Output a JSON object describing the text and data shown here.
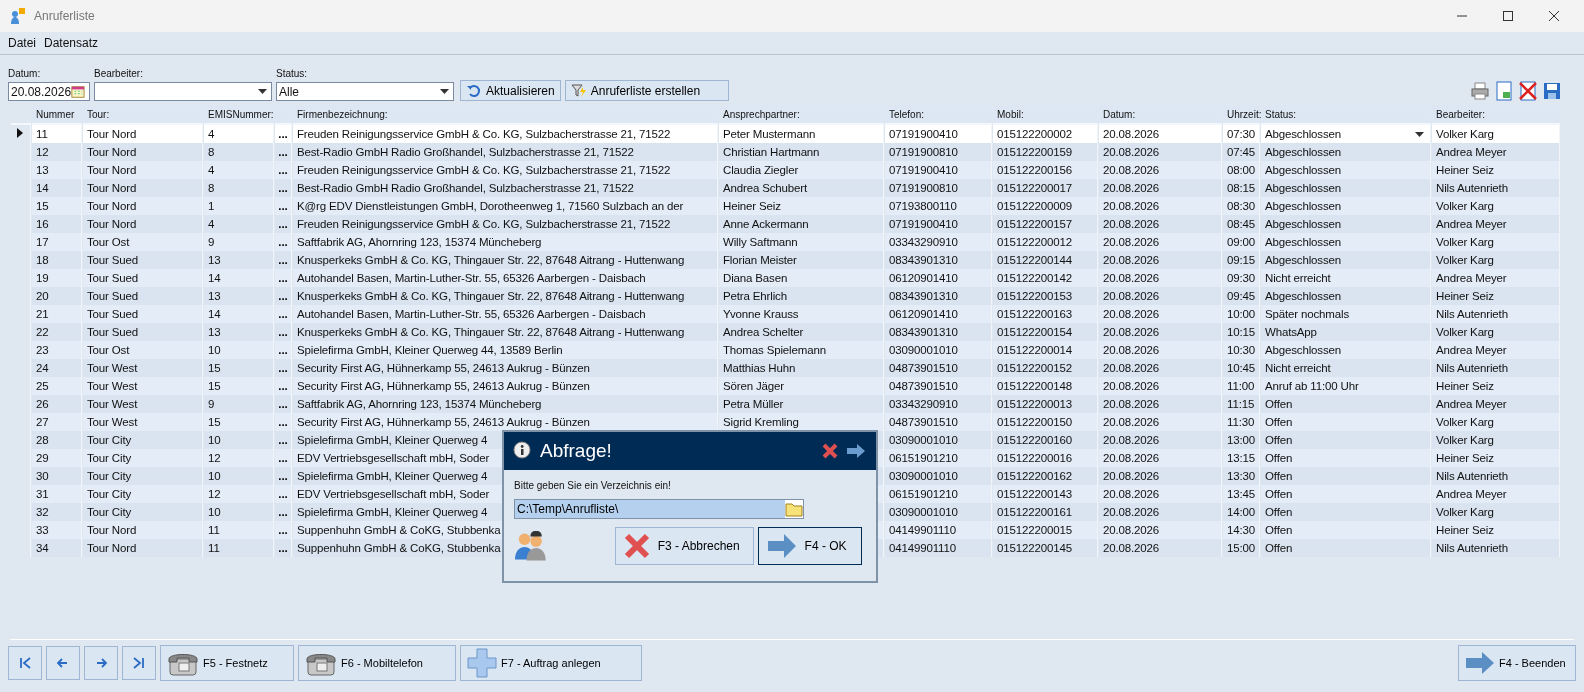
{
  "window": {
    "title": "Anruferliste"
  },
  "menu": [
    {
      "label": "Datei"
    },
    {
      "label": "Datensatz"
    }
  ],
  "filters": {
    "datum": {
      "label": "Datum:",
      "value": "20.08.2026"
    },
    "bearbeiter": {
      "label": "Bearbeiter:"
    },
    "status": {
      "label": "Status:",
      "value": "Alle"
    }
  },
  "actions": [
    {
      "kind": "refresh",
      "label": "Aktualisieren"
    },
    {
      "kind": "filter",
      "label": "Anruferliste erstellen"
    }
  ],
  "table": {
    "columns": [
      "Nummer",
      "Tour:",
      "EMISNummer:",
      "Firmenbezeichnung:",
      "Ansprechpartner:",
      "Telefon:",
      "Mobil:",
      "Datum:",
      "Uhrzeit:",
      "Status:",
      "Bearbeiter:"
    ],
    "rows": [
      {
        "selected": true,
        "more": "...",
        "cells": [
          "11",
          "Tour Nord",
          "4",
          "Freuden Reinigungsservice GmbH & Co. KG, Sulzbacherstrasse 21, 71522",
          "Peter Mustermann",
          "07191900410",
          "015122200002",
          "20.08.2026",
          "07:30",
          "Abgeschlossen",
          "Volker Karg"
        ]
      },
      {
        "selected": false,
        "more": "...",
        "cells": [
          "12",
          "Tour Nord",
          "8",
          "Best-Radio GmbH Radio Großhandel, Sulzbacherstrasse 21, 71522",
          "Christian Hartmann",
          "07191900810",
          "015122200159",
          "20.08.2026",
          "07:45",
          "Abgeschlossen",
          "Andrea Meyer"
        ]
      },
      {
        "selected": false,
        "more": "...",
        "cells": [
          "13",
          "Tour Nord",
          "4",
          "Freuden Reinigungsservice GmbH & Co. KG, Sulzbacherstrasse 21, 71522",
          "Claudia Ziegler",
          "07191900410",
          "015122200156",
          "20.08.2026",
          "08:00",
          "Abgeschlossen",
          "Heiner Seiz"
        ]
      },
      {
        "selected": false,
        "more": "...",
        "cells": [
          "14",
          "Tour Nord",
          "8",
          "Best-Radio GmbH Radio Großhandel, Sulzbacherstrasse 21, 71522",
          "Andrea Schubert",
          "07191900810",
          "015122200017",
          "20.08.2026",
          "08:15",
          "Abgeschlossen",
          "Nils Autenrieth"
        ]
      },
      {
        "selected": false,
        "more": "...",
        "cells": [
          "15",
          "Tour Nord",
          "1",
          "K@rg EDV Dienstleistungen GmbH, Dorotheenweg 1, 71560 Sulzbach an der",
          "Heiner Seiz",
          "07193800110",
          "015122200009",
          "20.08.2026",
          "08:30",
          "Abgeschlossen",
          "Volker Karg"
        ]
      },
      {
        "selected": false,
        "more": "...",
        "cells": [
          "16",
          "Tour Nord",
          "4",
          "Freuden Reinigungsservice GmbH & Co. KG, Sulzbacherstrasse 21, 71522",
          "Anne Ackermann",
          "07191900410",
          "015122200157",
          "20.08.2026",
          "08:45",
          "Abgeschlossen",
          "Andrea Meyer"
        ]
      },
      {
        "selected": false,
        "more": "...",
        "cells": [
          "17",
          "Tour Ost",
          "9",
          "Saftfabrik AG, Ahornring 123, 15374 Müncheberg",
          "Willy Saftmann",
          "03343290910",
          "015122200012",
          "20.08.2026",
          "09:00",
          "Abgeschlossen",
          "Volker Karg"
        ]
      },
      {
        "selected": false,
        "more": "...",
        "cells": [
          "18",
          "Tour Sued",
          "13",
          "Knusperkeks GmbH & Co. KG, Thingauer Str. 22, 87648 Aitrang - Huttenwang",
          "Florian Meister",
          "08343901310",
          "015122200144",
          "20.08.2026",
          "09:15",
          "Abgeschlossen",
          "Volker Karg"
        ]
      },
      {
        "selected": false,
        "more": "...",
        "cells": [
          "19",
          "Tour Sued",
          "14",
          "Autohandel Basen, Martin-Luther-Str. 55, 65326 Aarbergen - Daisbach",
          "Diana Basen",
          "06120901410",
          "015122200142",
          "20.08.2026",
          "09:30",
          "Nicht erreicht",
          "Andrea Meyer"
        ]
      },
      {
        "selected": false,
        "more": "...",
        "cells": [
          "20",
          "Tour Sued",
          "13",
          "Knusperkeks GmbH & Co. KG, Thingauer Str. 22, 87648 Aitrang - Huttenwang",
          "Petra Ehrlich",
          "08343901310",
          "015122200153",
          "20.08.2026",
          "09:45",
          "Abgeschlossen",
          "Heiner Seiz"
        ]
      },
      {
        "selected": false,
        "more": "...",
        "cells": [
          "21",
          "Tour Sued",
          "14",
          "Autohandel Basen, Martin-Luther-Str. 55, 65326 Aarbergen - Daisbach",
          "Yvonne Krauss",
          "06120901410",
          "015122200163",
          "20.08.2026",
          "10:00",
          "Später nochmals",
          "Nils Autenrieth"
        ]
      },
      {
        "selected": false,
        "more": "...",
        "cells": [
          "22",
          "Tour Sued",
          "13",
          "Knusperkeks GmbH & Co. KG, Thingauer Str. 22, 87648 Aitrang - Huttenwang",
          "Andrea Schelter",
          "08343901310",
          "015122200154",
          "20.08.2026",
          "10:15",
          "WhatsApp",
          "Volker Karg"
        ]
      },
      {
        "selected": false,
        "more": "...",
        "cells": [
          "23",
          "Tour Ost",
          "10",
          "Spielefirma GmbH, Kleiner Querweg 44, 13589 Berlin",
          "Thomas Spielemann",
          "03090001010",
          "015122200014",
          "20.08.2026",
          "10:30",
          "Abgeschlossen",
          "Andrea Meyer"
        ]
      },
      {
        "selected": false,
        "more": "...",
        "cells": [
          "24",
          "Tour West",
          "15",
          "Security First AG, Hühnerkamp 55, 24613 Aukrug - Bünzen",
          "Matthias Huhn",
          "04873901510",
          "015122200152",
          "20.08.2026",
          "10:45",
          "Nicht erreicht",
          "Nils Autenrieth"
        ]
      },
      {
        "selected": false,
        "more": "...",
        "cells": [
          "25",
          "Tour West",
          "15",
          "Security First AG, Hühnerkamp 55, 24613 Aukrug - Bünzen",
          "Sören Jäger",
          "04873901510",
          "015122200148",
          "20.08.2026",
          "11:00",
          "Anruf ab 11:00 Uhr",
          "Heiner Seiz"
        ]
      },
      {
        "selected": false,
        "more": "...",
        "cells": [
          "26",
          "Tour West",
          "9",
          "Saftfabrik AG, Ahornring 123, 15374 Müncheberg",
          "Petra Müller",
          "03343290910",
          "015122200013",
          "20.08.2026",
          "11:15",
          "Offen",
          "Andrea Meyer"
        ]
      },
      {
        "selected": false,
        "more": "...",
        "cells": [
          "27",
          "Tour West",
          "15",
          "Security First AG, Hühnerkamp 55, 24613 Aukrug - Bünzen",
          "Sigrid Kremling",
          "04873901510",
          "015122200150",
          "20.08.2026",
          "11:30",
          "Offen",
          "Volker Karg"
        ]
      },
      {
        "selected": false,
        "more": "...",
        "cells": [
          "28",
          "Tour City",
          "10",
          "Spielefirma GmbH, Kleiner Querweg 4",
          null,
          "03090001010",
          "015122200160",
          "20.08.2026",
          "13:00",
          "Offen",
          "Volker Karg"
        ]
      },
      {
        "selected": false,
        "more": "...",
        "cells": [
          "29",
          "Tour City",
          "12",
          "EDV Vertriebsgesellschaft mbH, Soder",
          null,
          "06151901210",
          "015122200016",
          "20.08.2026",
          "13:15",
          "Offen",
          "Heiner Seiz"
        ]
      },
      {
        "selected": false,
        "more": "...",
        "cells": [
          "30",
          "Tour City",
          "10",
          "Spielefirma GmbH, Kleiner Querweg 4",
          null,
          "03090001010",
          "015122200162",
          "20.08.2026",
          "13:30",
          "Offen",
          "Nils Autenrieth"
        ]
      },
      {
        "selected": false,
        "more": "...",
        "cells": [
          "31",
          "Tour City",
          "12",
          "EDV Vertriebsgesellschaft mbH, Soder",
          null,
          "06151901210",
          "015122200143",
          "20.08.2026",
          "13:45",
          "Offen",
          "Andrea Meyer"
        ]
      },
      {
        "selected": false,
        "more": "...",
        "cells": [
          "32",
          "Tour City",
          "10",
          "Spielefirma GmbH, Kleiner Querweg 4",
          null,
          "03090001010",
          "015122200161",
          "20.08.2026",
          "14:00",
          "Offen",
          "Volker Karg"
        ]
      },
      {
        "selected": false,
        "more": "...",
        "cells": [
          "33",
          "Tour Nord",
          "11",
          "Suppenhuhn GmbH & CoKG, Stubbenka",
          null,
          "04149901110",
          "015122200015",
          "20.08.2026",
          "14:30",
          "Offen",
          "Heiner Seiz"
        ]
      },
      {
        "selected": false,
        "more": "...",
        "cells": [
          "34",
          "Tour Nord",
          "11",
          "Suppenhuhn GmbH & CoKG, Stubbenka",
          null,
          "04149901110",
          "015122200145",
          "20.08.2026",
          "15:00",
          "Offen",
          "Nils Autenrieth"
        ]
      }
    ]
  },
  "dialog": {
    "title": "Abfrage!",
    "message": "Bitte geben Sie ein Verzeichnis ein!",
    "path": "C:\\Temp\\Anrufliste\\",
    "buttons": [
      {
        "kind": "cancel",
        "label": "F3 - Abbrechen"
      },
      {
        "kind": "ok",
        "label": "F4 - OK"
      }
    ]
  },
  "footer": {
    "nav": [
      {
        "kind": "first"
      },
      {
        "kind": "prev"
      },
      {
        "kind": "next"
      },
      {
        "kind": "last"
      }
    ],
    "buttons": [
      {
        "kind": "phone",
        "label": "F5 - Festnetz"
      },
      {
        "kind": "phone",
        "label": "F6 - Mobiltelefon"
      },
      {
        "kind": "plus",
        "label": "F7 - Auftrag anlegen"
      }
    ],
    "exit": {
      "kind": "arrow",
      "label": "F4 - Beenden"
    }
  }
}
